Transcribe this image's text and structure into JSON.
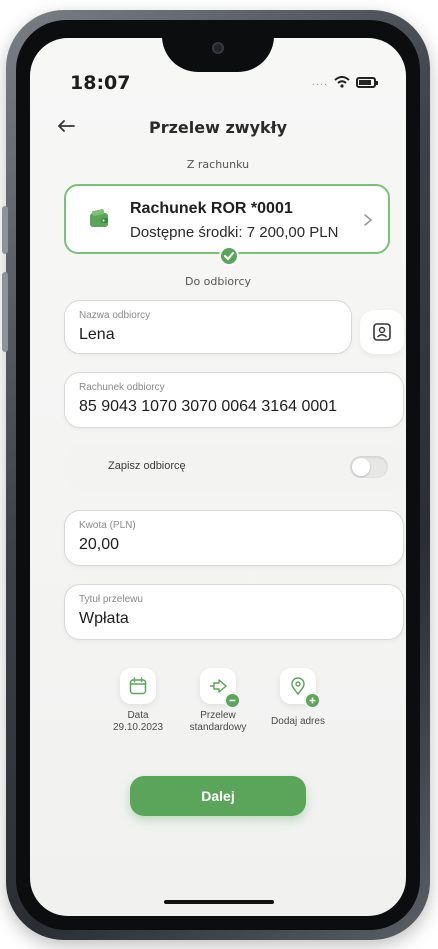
{
  "status_bar": {
    "time": "18:07",
    "signal_dots": "....",
    "icons": [
      "wifi-icon",
      "battery-icon"
    ]
  },
  "header": {
    "title": "Przelew zwykły",
    "back_icon": "arrow-left-icon"
  },
  "from_account": {
    "section_label": "Z rachunku",
    "name": "Rachunek ROR *0001",
    "balance": "Dostępne środki: 7 200,00 PLN",
    "icon": "wallet-icon",
    "selected": true
  },
  "recipient": {
    "section_label": "Do odbiorcy",
    "name_field": {
      "label": "Nazwa odbiorcy",
      "value": "Lena"
    },
    "account_field": {
      "label": "Rachunek odbiorcy",
      "value": "85 9043 1070 3070 0064 3164 0001"
    },
    "save_toggle": {
      "label": "Zapisz odbiorcę",
      "on": false
    },
    "contacts_icon": "contact-book-icon"
  },
  "amount_field": {
    "label": "Kwota (PLN)",
    "value": "20,00"
  },
  "title_field": {
    "label": "Tytuł przelewu",
    "value": "Wpłata"
  },
  "options": [
    {
      "name": "date",
      "icon": "calendar-icon",
      "line1": "Data",
      "line2": "29.10.2023",
      "badge": false
    },
    {
      "name": "transfer-type",
      "icon": "arrow-right-icon",
      "line1": "Przelew",
      "line2": "standardowy",
      "badge": true
    },
    {
      "name": "add-address",
      "icon": "location-pin-icon",
      "line1": "Dodaj adres",
      "line2": "",
      "badge": true
    }
  ],
  "next_button": {
    "label": "Dalej"
  },
  "colors": {
    "accent": "#5aa55a",
    "card_border": "#7cbf7a",
    "background": "#f3f4f2"
  }
}
